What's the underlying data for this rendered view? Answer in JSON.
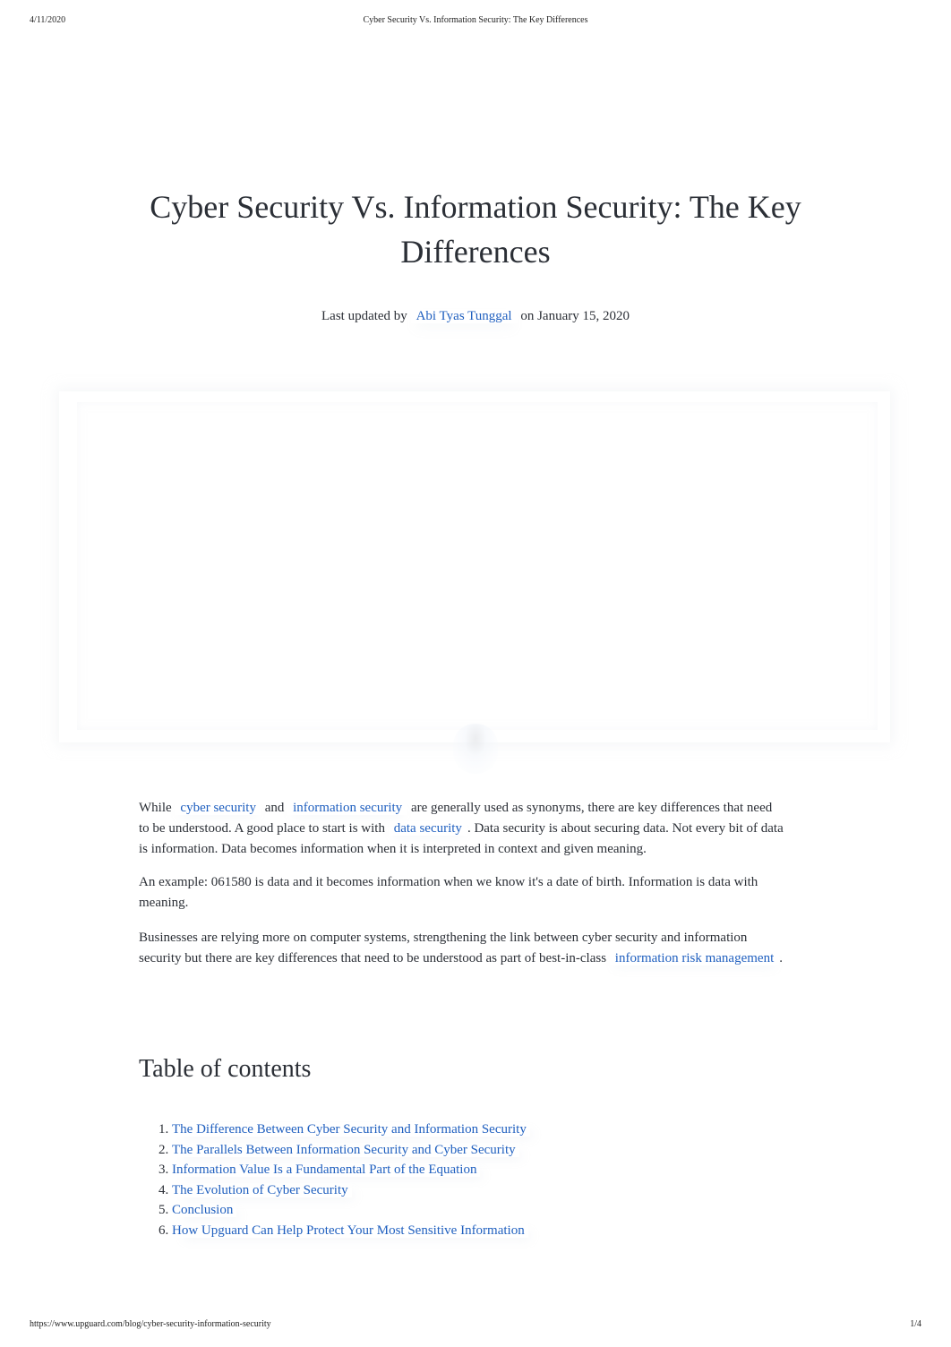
{
  "print_header": {
    "date": "4/11/2020",
    "title": "Cyber Security Vs. Information Security: The Key Differences"
  },
  "article": {
    "title": "Cyber Security Vs. Information Security: The Key Differences",
    "byline": {
      "prefix": "Last updated by",
      "author": "Abi Tyas Tunggal",
      "suffix": "on January 15, 2020"
    },
    "paragraphs": {
      "p1": {
        "t1": "While ",
        "link1": "cyber security",
        "t2": " and ",
        "link2": "information security",
        "t3": " are generally used as synonyms, there are key differences that need to be understood. A good place to start is with ",
        "link3": "data security",
        "t4": ". Data security is about securing data. Not every bit of data is information. Data becomes information when it is interpreted in context and given meaning."
      },
      "p2": "An example: 061580 is data and it becomes information when we know it's a date of birth. Information is data with meaning.",
      "p3": {
        "t1": "Businesses are relying more on computer systems, strengthening the link between cyber security and information security but there are key differences that need to be understood as part of best-in-class ",
        "link1": "information risk management",
        "t2": "."
      }
    },
    "toc": {
      "heading": "Table of contents",
      "items": [
        "The Difference Between Cyber Security and Information Security",
        "The Parallels Between Information Security and Cyber Security",
        "Information Value Is a Fundamental Part of the Equation",
        "The Evolution of Cyber Security",
        "Conclusion",
        "How Upguard Can Help Protect Your Most Sensitive Information"
      ]
    }
  },
  "print_footer": {
    "url": "https://www.upguard.com/blog/cyber-security-information-security",
    "page": "1/4"
  },
  "colors": {
    "link": "#1f5fbf",
    "text": "#2b2f36"
  }
}
